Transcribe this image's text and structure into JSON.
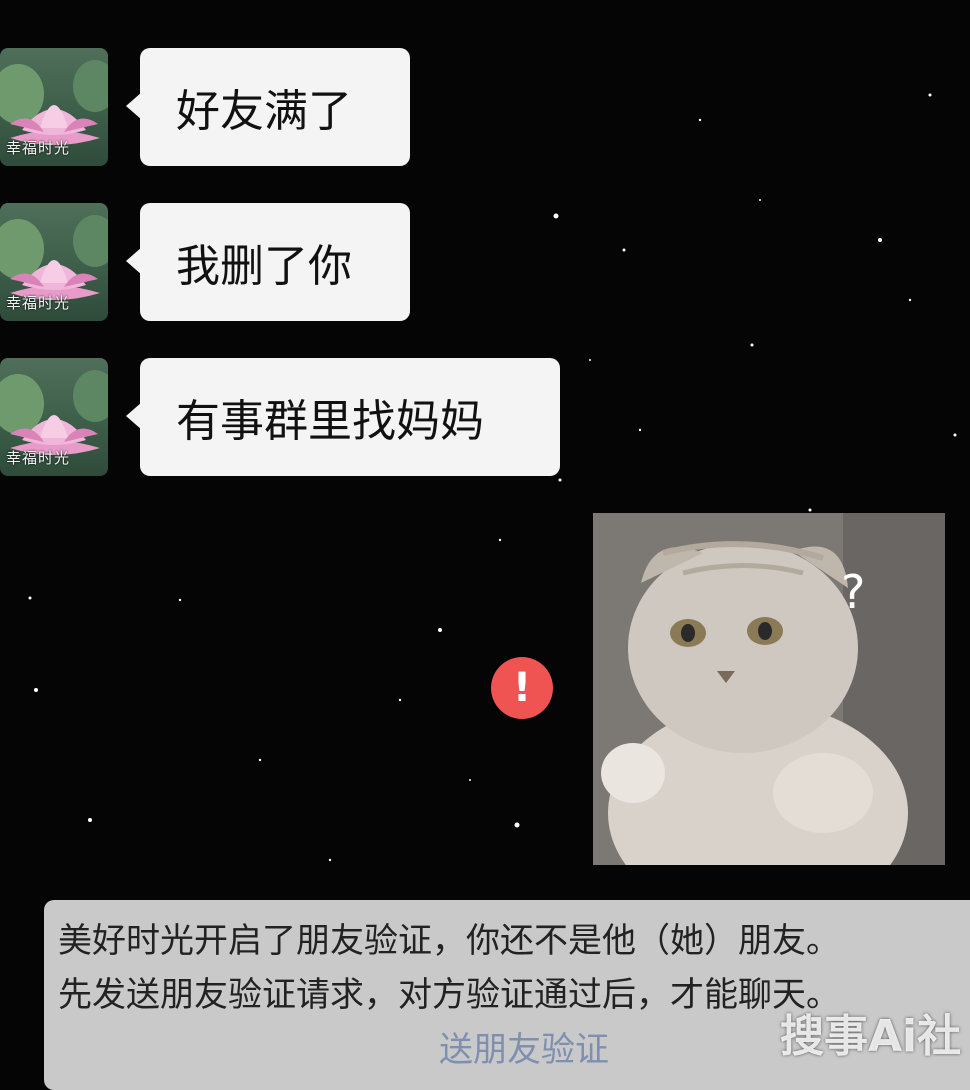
{
  "messages": [
    {
      "sender_caption": "幸福时光",
      "text": "好友满了"
    },
    {
      "sender_caption": "幸福时光",
      "text": "我删了你"
    },
    {
      "sender_caption": "幸福时光",
      "text": "有事群里找妈妈"
    }
  ],
  "sent_sticker": {
    "icon": "cat-sticker-icon",
    "overlay_text": "?",
    "status_icon": "send-failed-icon",
    "status_text": "!"
  },
  "system_notice": {
    "line1": "美好时光开启了朋友验证，你还不是他（她）朋友。",
    "line2": "先发送朋友验证请求，对方验证通过后，才能聊天。",
    "link_text": "送朋友验证"
  },
  "watermark": "搜事Ai社",
  "colors": {
    "bubble": "#f4f4f4",
    "error_badge": "#ef5453",
    "notice_bg": "#c9c9c9",
    "link": "#7e8fb0",
    "background": "#050505"
  }
}
